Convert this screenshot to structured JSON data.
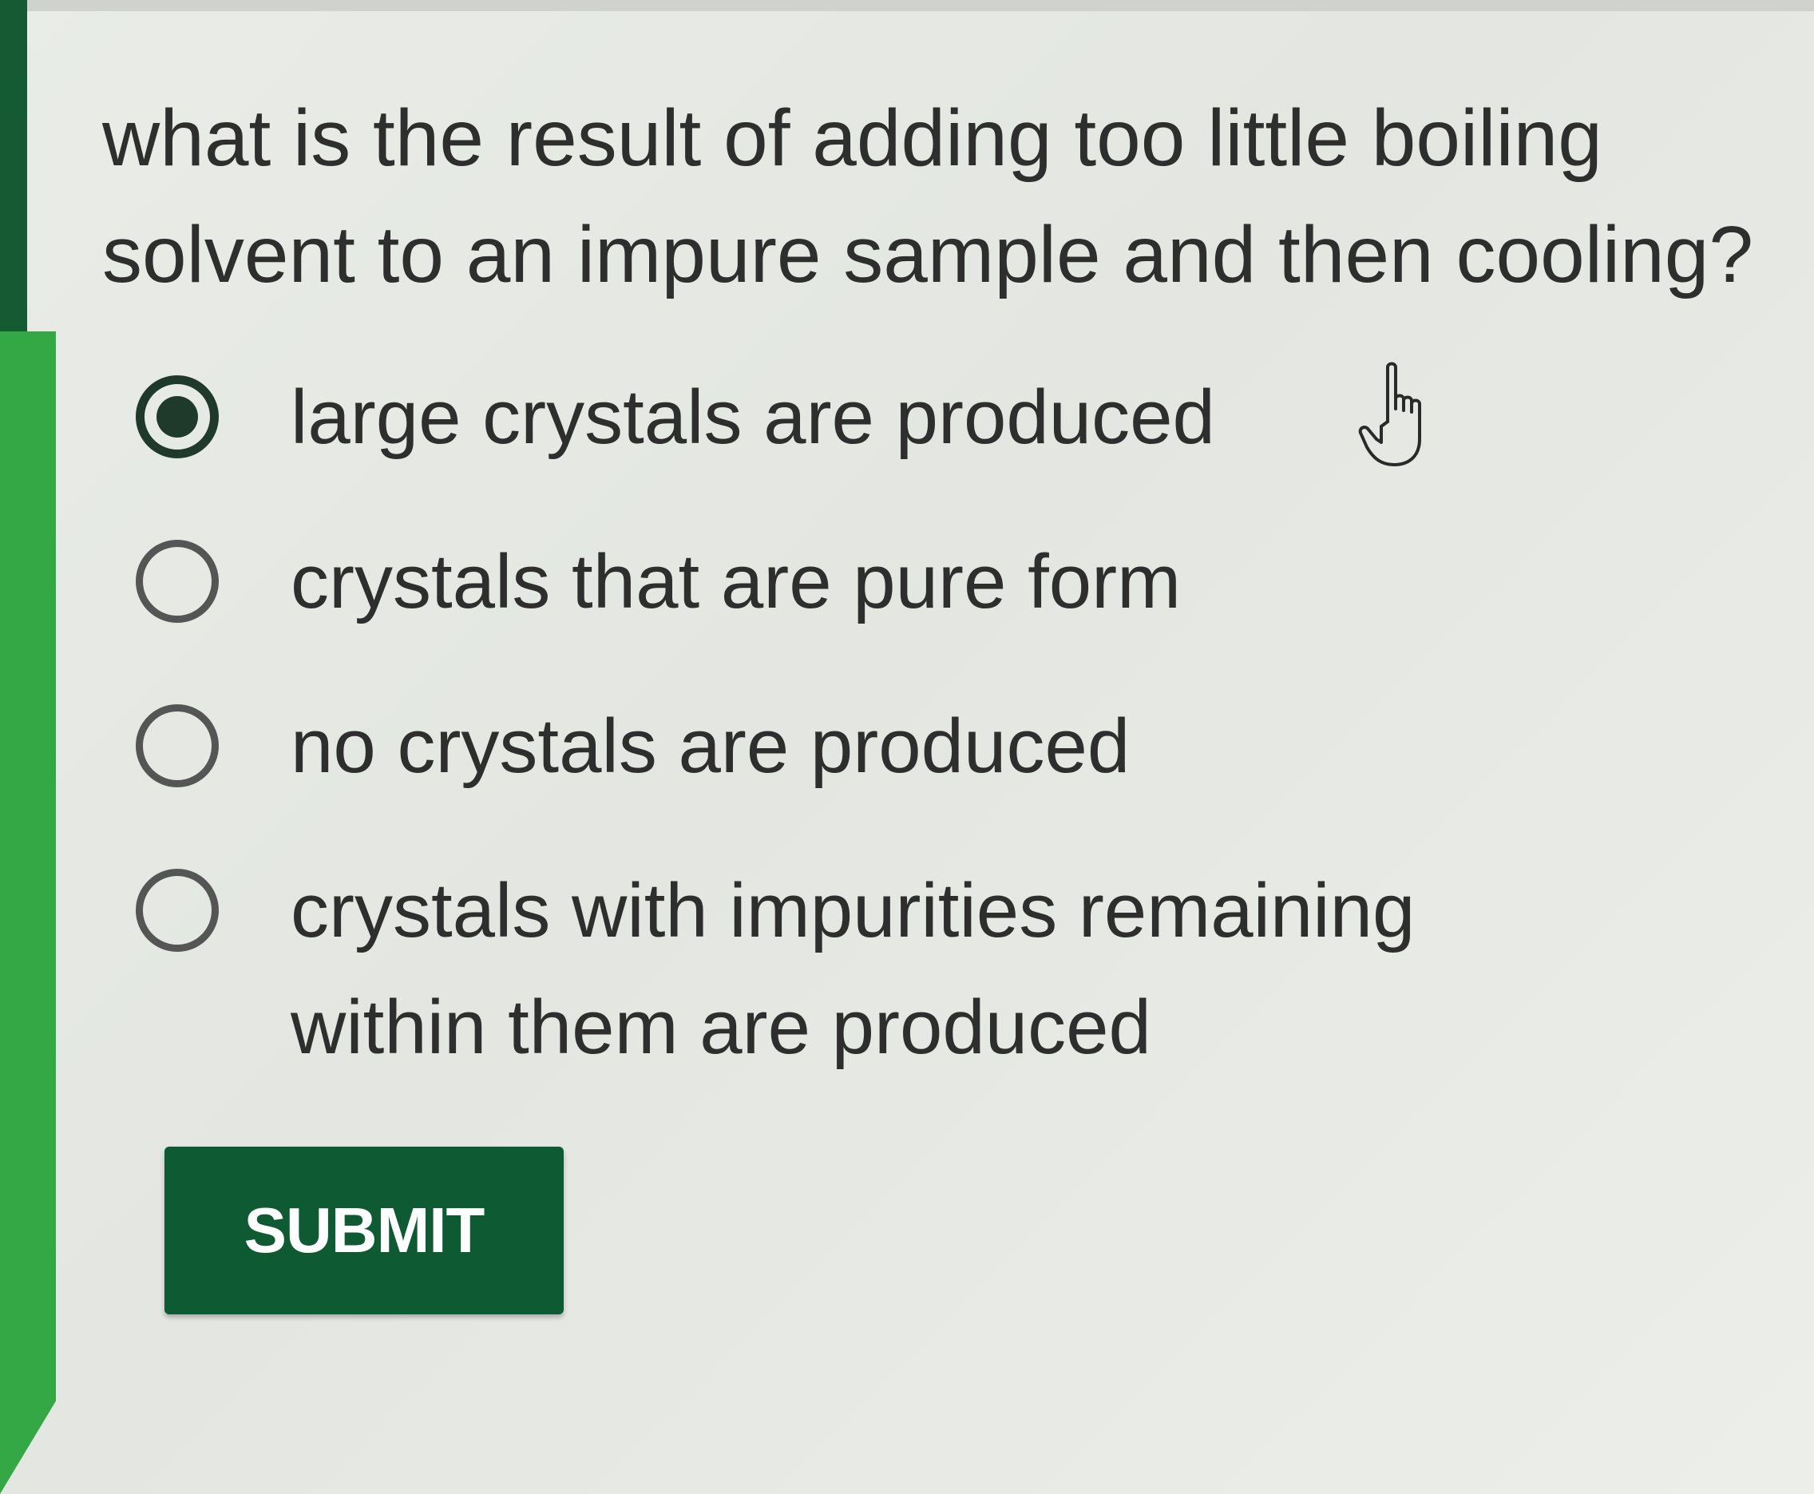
{
  "question": {
    "text": "what is the result of adding too little boiling solvent to an impure sample and then cooling?"
  },
  "options": [
    {
      "label": "large crystals are produced",
      "selected": true
    },
    {
      "label": "crystals that are pure form",
      "selected": false
    },
    {
      "label": "no crystals are produced",
      "selected": false
    },
    {
      "label": "crystals with impurities remaining within them are produced",
      "selected": false
    }
  ],
  "submit": {
    "label": "SUBMIT"
  },
  "colors": {
    "accent_dark": "#0e5a33",
    "sidebar_dark": "#145a32",
    "sidebar_green": "#33a844"
  },
  "icons": {
    "cursor": "hand-pointer-icon"
  }
}
